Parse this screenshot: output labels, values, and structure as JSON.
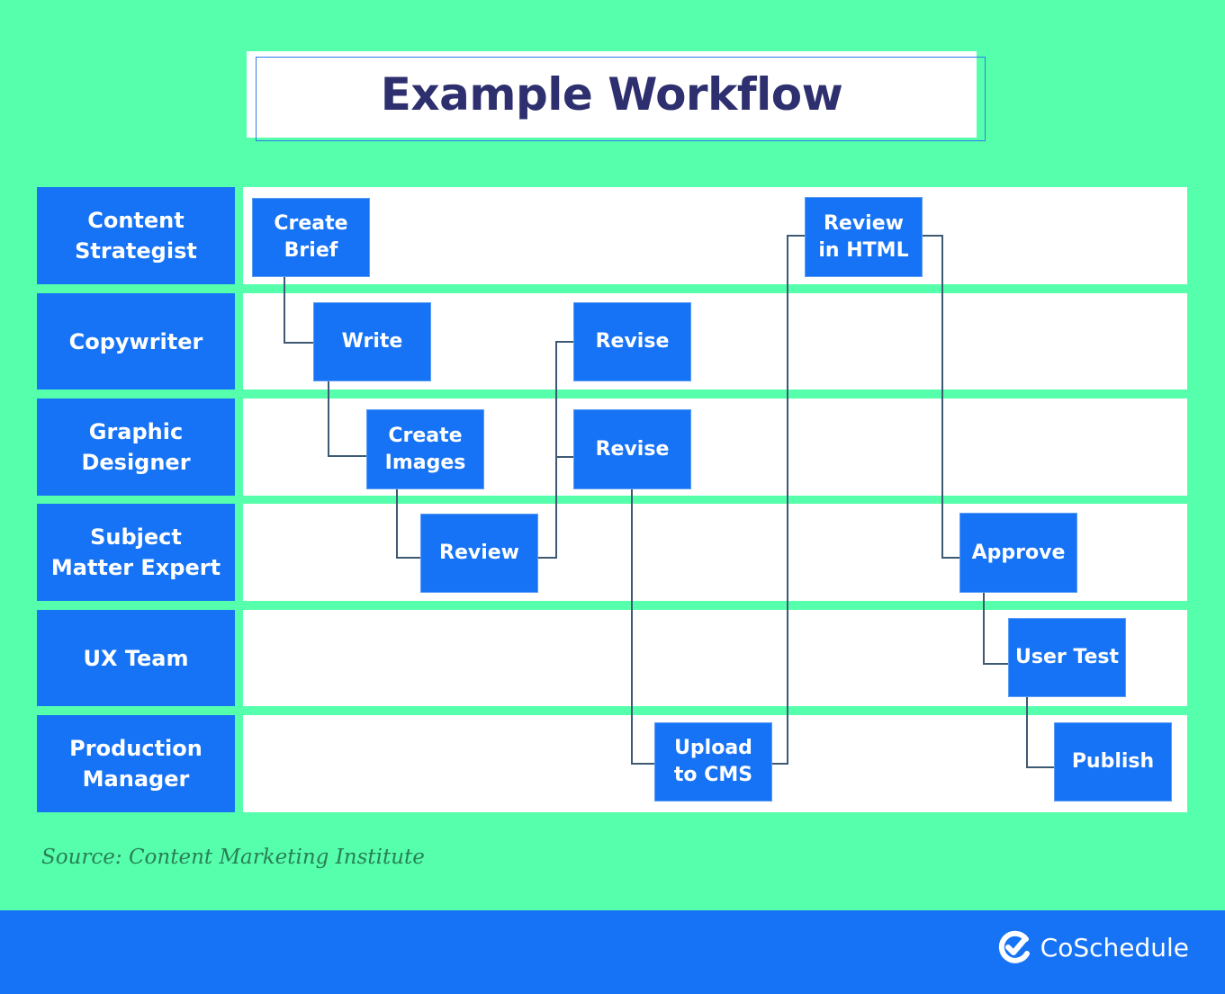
{
  "title": "Example Workflow",
  "lanes": [
    {
      "label": "Content\nStrategist"
    },
    {
      "label": "Copywriter"
    },
    {
      "label": "Graphic\nDesigner"
    },
    {
      "label": "Subject\nMatter Expert"
    },
    {
      "label": "UX Team"
    },
    {
      "label": "Production\nManager"
    }
  ],
  "nodes": [
    {
      "label": "Create\nBrief",
      "lane": "Content Strategist"
    },
    {
      "label": "Write",
      "lane": "Copywriter"
    },
    {
      "label": "Create\nImages",
      "lane": "Graphic Designer"
    },
    {
      "label": "Review",
      "lane": "Subject Matter Expert"
    },
    {
      "label": "Revise",
      "lane": "Copywriter"
    },
    {
      "label": "Revise",
      "lane": "Graphic Designer"
    },
    {
      "label": "Upload\nto CMS",
      "lane": "Production Manager"
    },
    {
      "label": "Review\nin HTML",
      "lane": "Content Strategist"
    },
    {
      "label": "Approve",
      "lane": "Subject Matter Expert"
    },
    {
      "label": "User Test",
      "lane": "UX Team"
    },
    {
      "label": "Publish",
      "lane": "Production Manager"
    }
  ],
  "source": "Source: Content Marketing Institute",
  "footer": {
    "brand": "CoSchedule",
    "icon": "coschedule-check-icon"
  },
  "colors": {
    "background": "#55ffac",
    "node": "#1673f5",
    "title": "#2d2f6e",
    "connector": "#3e5a73"
  }
}
